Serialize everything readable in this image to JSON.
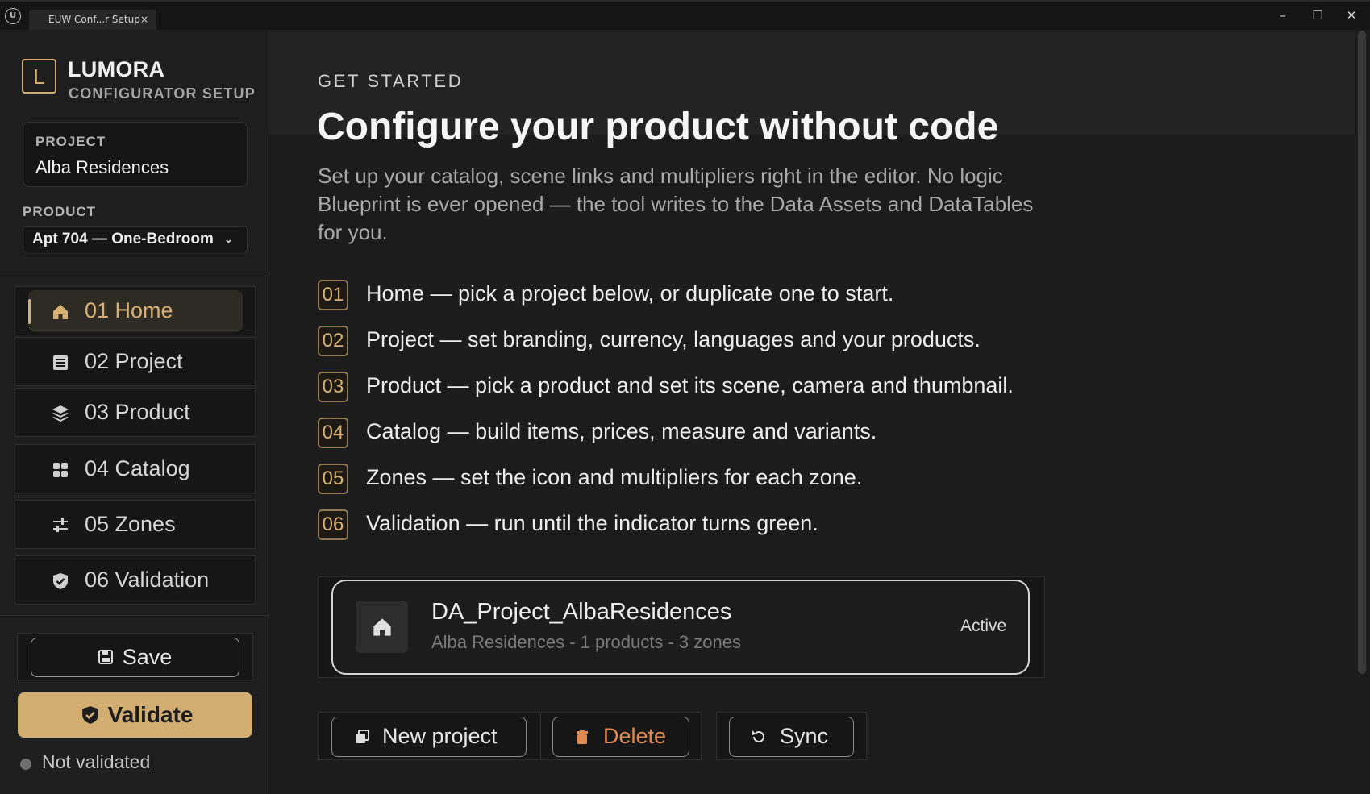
{
  "window": {
    "tab_title": "EUW Conf...r Setup",
    "tab_close": "×",
    "logo_text": "U",
    "minimize": "–",
    "maximize": "☐",
    "close": "✕"
  },
  "sidebar": {
    "brand": {
      "logo_letter": "L",
      "name": "LUMORA",
      "subtitle": "CONFIGURATOR SETUP"
    },
    "project": {
      "label": "PROJECT",
      "value": "Alba Residences"
    },
    "product": {
      "label": "PRODUCT",
      "selected": "Apt 704 — One-Bedroom",
      "chevron": "⌄"
    },
    "nav": [
      {
        "label": "01  Home",
        "icon": "home-icon",
        "active": true
      },
      {
        "label": "02  Project",
        "icon": "list-icon",
        "active": false
      },
      {
        "label": "03  Product",
        "icon": "layers-icon",
        "active": false
      },
      {
        "label": "04  Catalog",
        "icon": "grid-icon",
        "active": false
      },
      {
        "label": "05  Zones",
        "icon": "sliders-icon",
        "active": false
      },
      {
        "label": "06  Validation",
        "icon": "shield-check-icon",
        "active": false
      }
    ],
    "save_label": "Save",
    "validate_label": "Validate",
    "status_text": "Not validated"
  },
  "main": {
    "eyebrow": "GET STARTED",
    "headline": "Configure your product without code",
    "intro": "Set up your catalog, scene links and multipliers right in the editor. No logic Blueprint is ever opened — the tool writes to the Data Assets and DataTables for you.",
    "steps": [
      {
        "num": "01",
        "text": "Home — pick a project below, or duplicate one to start."
      },
      {
        "num": "02",
        "text": "Project — set branding, currency, languages and your products."
      },
      {
        "num": "03",
        "text": "Product — pick a product and set its scene, camera and thumbnail."
      },
      {
        "num": "04",
        "text": "Catalog — build items, prices, measure and variants."
      },
      {
        "num": "05",
        "text": "Zones — set the icon and multipliers for each zone."
      },
      {
        "num": "06",
        "text": "Validation — run until the indicator turns green."
      }
    ],
    "project_card": {
      "name": "DA_Project_AlbaResidences",
      "meta": "Alba Residences - 1 products - 3 zones",
      "badge": "Active"
    },
    "actions": {
      "new_project": "New project",
      "delete": "Delete",
      "sync": "Sync"
    }
  },
  "colors": {
    "accent": "#d1ad72",
    "danger": "#e08a4f",
    "background": "#1c1c1c"
  }
}
